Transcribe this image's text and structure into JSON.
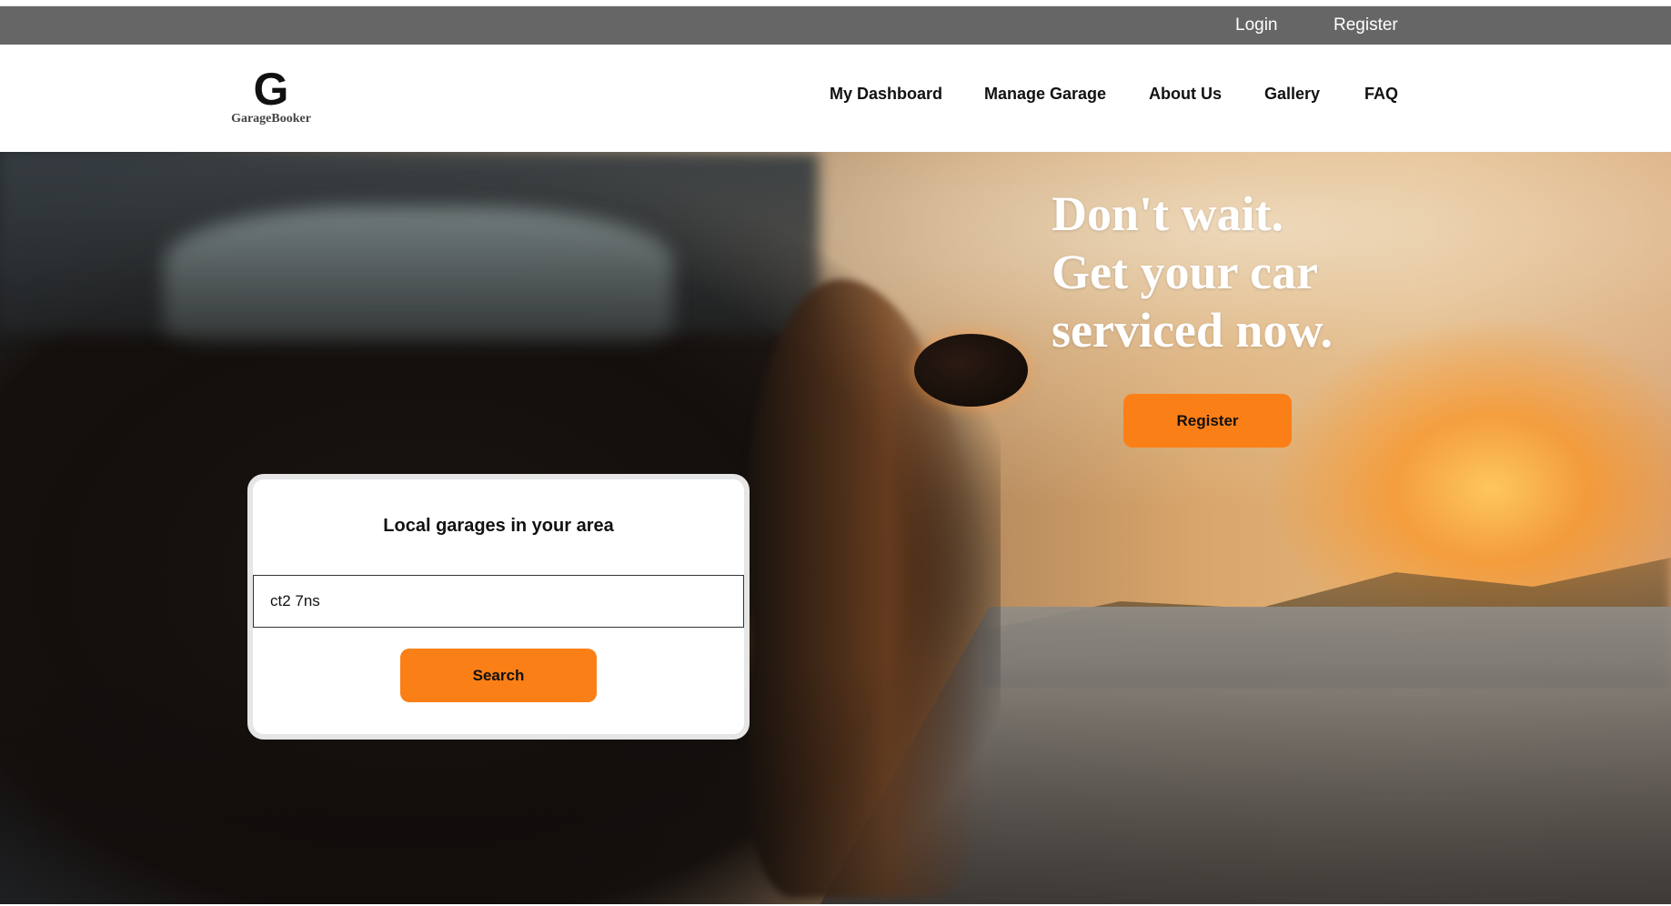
{
  "utility_bar": {
    "login_label": "Login",
    "register_label": "Register",
    "background": "#666666"
  },
  "brand": {
    "logo_letter": "G",
    "name": "GarageBooker"
  },
  "nav": {
    "items": [
      {
        "label": "My Dashboard"
      },
      {
        "label": "Manage Garage"
      },
      {
        "label": "About Us"
      },
      {
        "label": "Gallery"
      },
      {
        "label": "FAQ"
      }
    ]
  },
  "hero": {
    "headline_lines": [
      "Don't wait.",
      "Get your car",
      "serviced now."
    ],
    "register_label": "Register",
    "accent_color": "#fb7f17"
  },
  "search": {
    "title": "Local garages in your area",
    "input_value": "ct2 7ns",
    "button_label": "Search"
  }
}
